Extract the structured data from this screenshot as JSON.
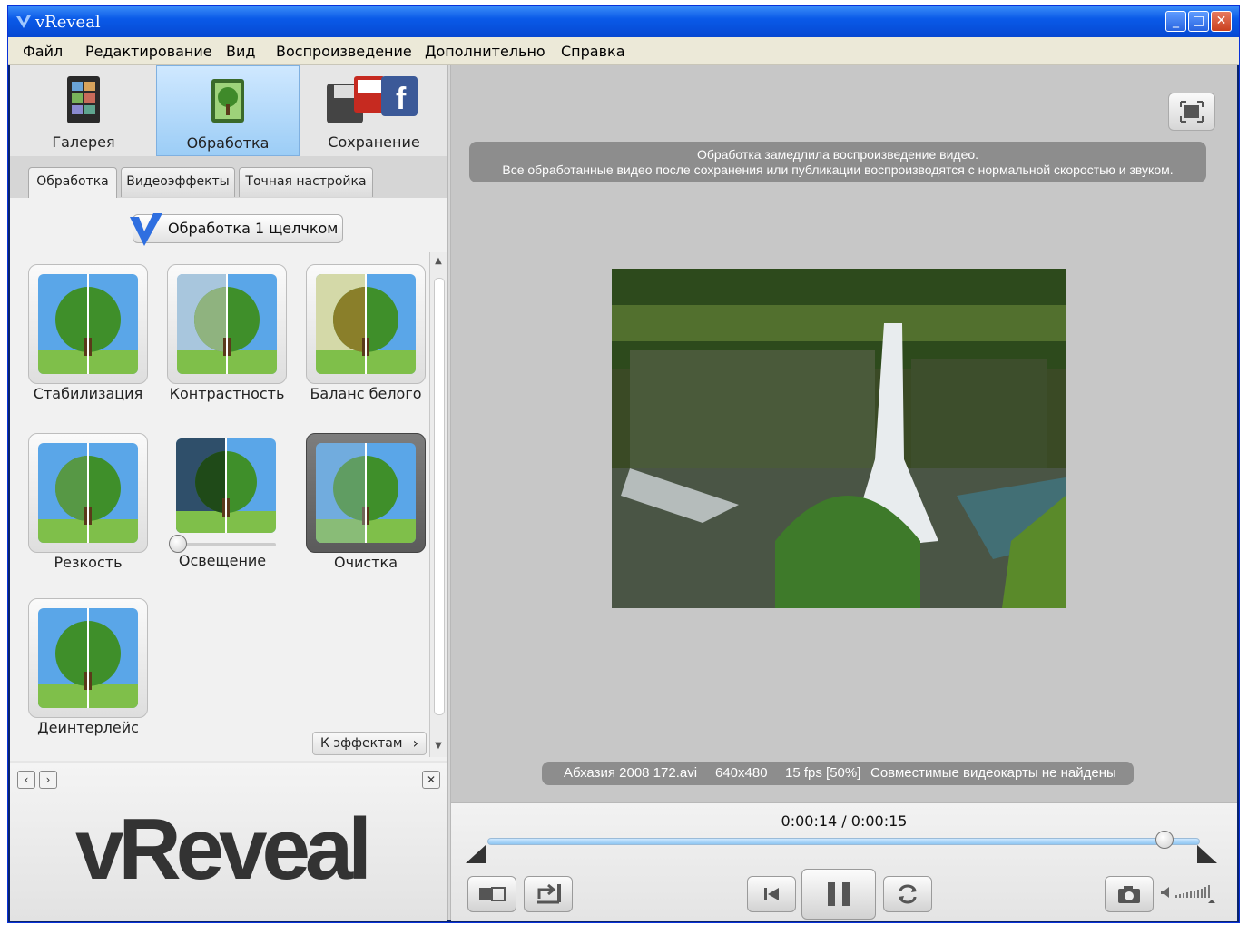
{
  "window": {
    "title": "vReveal",
    "minimize": "_",
    "maximize": "□",
    "close": "✕"
  },
  "menu": [
    "Файл",
    "Редактирование",
    "Вид",
    "Воспроизведение",
    "Дополнительно",
    "Справка"
  ],
  "main_tabs": [
    {
      "label": "Галерея",
      "icon": "gallery-icon"
    },
    {
      "label": "Обработка",
      "icon": "processing-icon",
      "active": true
    },
    {
      "label": "Сохранение",
      "icon": "save-share-icon"
    }
  ],
  "sub_tabs": [
    {
      "label": "Обработка",
      "active": true
    },
    {
      "label": "Видеоэффекты"
    },
    {
      "label": "Точная настройка"
    }
  ],
  "one_click_label": "Обработка 1 щелчком",
  "effects": [
    {
      "label": "Стабилизация"
    },
    {
      "label": "Контрастность"
    },
    {
      "label": "Баланс белого"
    },
    {
      "label": "Резкость"
    },
    {
      "label": "Освещение",
      "slider_level": 0.0
    },
    {
      "label": "Очистка",
      "selected": true
    },
    {
      "label": "Деинтерлейс"
    }
  ],
  "to_effects_label": "К эффектам",
  "logo_text": "vReveal",
  "notice": {
    "line1": "Обработка замедлила воспроизведение видео.",
    "line2": "Все обработанные видео после сохранения или публикации воспроизводятся с нормальной скоростью и звуком."
  },
  "status": {
    "file": "Абхазия 2008 172.avi",
    "resolution": "640x480",
    "fps": "15 fps [50%]",
    "gpu": "Совместимые видеокарты не найдены"
  },
  "playback": {
    "time": "0:00:14 / 0:00:15",
    "progress": 0.95
  },
  "colors": {
    "accent": "#9ccdf6",
    "titlebar": "#0a5ae8",
    "overlay": "#8d8d8d"
  }
}
